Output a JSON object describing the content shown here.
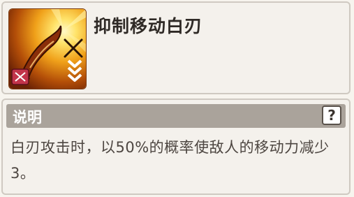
{
  "skill": {
    "title": "抑制移动白刃",
    "icon": "blade-debuff-icon",
    "icon_colors": {
      "glow": "#fff2a0",
      "fire": "#e58a12",
      "dark": "#7a2a06",
      "badge": "#c2344a"
    }
  },
  "description": {
    "header_label": "说明",
    "help_label": "?",
    "text": "白刃攻击时，以50%的概率使敌人的移动力减少3。"
  },
  "colors": {
    "panel_bg": "#f4f1ec",
    "panel_border": "#cfc9c1",
    "header_bg": "#aaa39b",
    "title_text": "#2f2a26",
    "body_text": "#4d4641"
  }
}
